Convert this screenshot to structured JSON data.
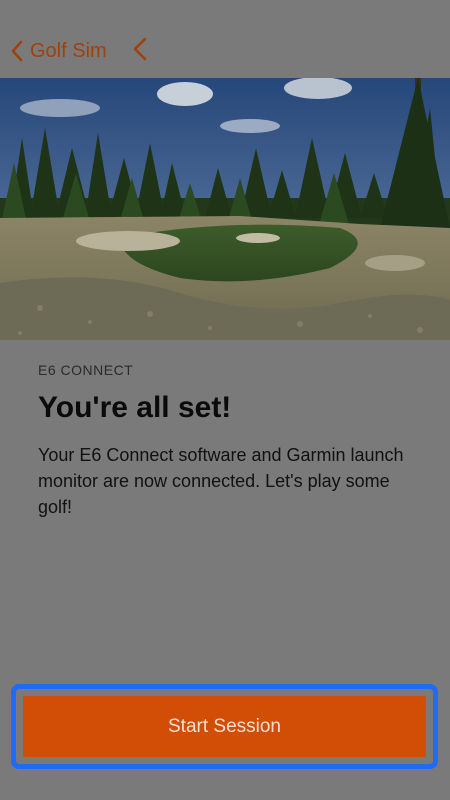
{
  "nav": {
    "back_label": "Golf Sim",
    "accent_color": "#a0410c",
    "back_icon": "chevron-left-icon",
    "secondary_icon": "chevron-left-icon"
  },
  "hero": {
    "image": "golf-course-fairway-bunker-trees"
  },
  "content": {
    "eyebrow": "E6 CONNECT",
    "title": "You're all set!",
    "body": "Your E6 Connect software and Garmin launch monitor are now connected. Let's play some golf!"
  },
  "cta": {
    "label": "Start Session",
    "color": "#d24d06",
    "highlight_color": "#1f6af7"
  }
}
